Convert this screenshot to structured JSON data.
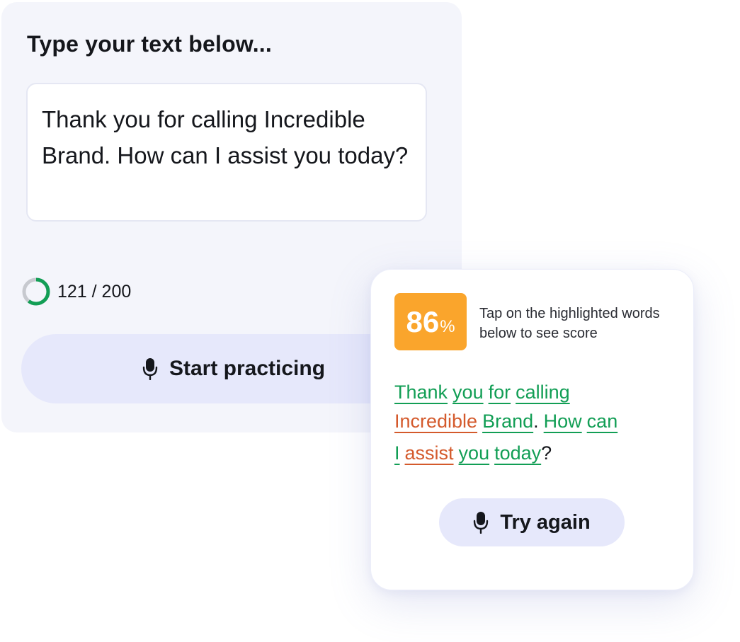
{
  "editor": {
    "heading": "Type your text below...",
    "text": "Thank you for calling Incredible Brand. How can I assist you today?",
    "char_count_label": "121 / 200",
    "char_count": 121,
    "char_limit": 200
  },
  "start_button": {
    "label": "Start practicing",
    "icon": "microphone-icon"
  },
  "result": {
    "score_value": "86",
    "score_unit": "%",
    "score_color": "#faa52c",
    "hint": "Tap on the highlighted words below to see score",
    "words": {
      "w1": "Thank",
      "w2": "you",
      "w3": "for",
      "w4": "calling",
      "w5": "Incredible",
      "w6": "Brand",
      "p1": ".",
      "w7": "How",
      "w8": "can",
      "w9": "I",
      "w10": "assist",
      "w11": "you",
      "w12": "today",
      "p2": "?"
    },
    "colors": {
      "good": "#129e55",
      "bad": "#d45a2c"
    },
    "try_again_label": "Try again"
  }
}
